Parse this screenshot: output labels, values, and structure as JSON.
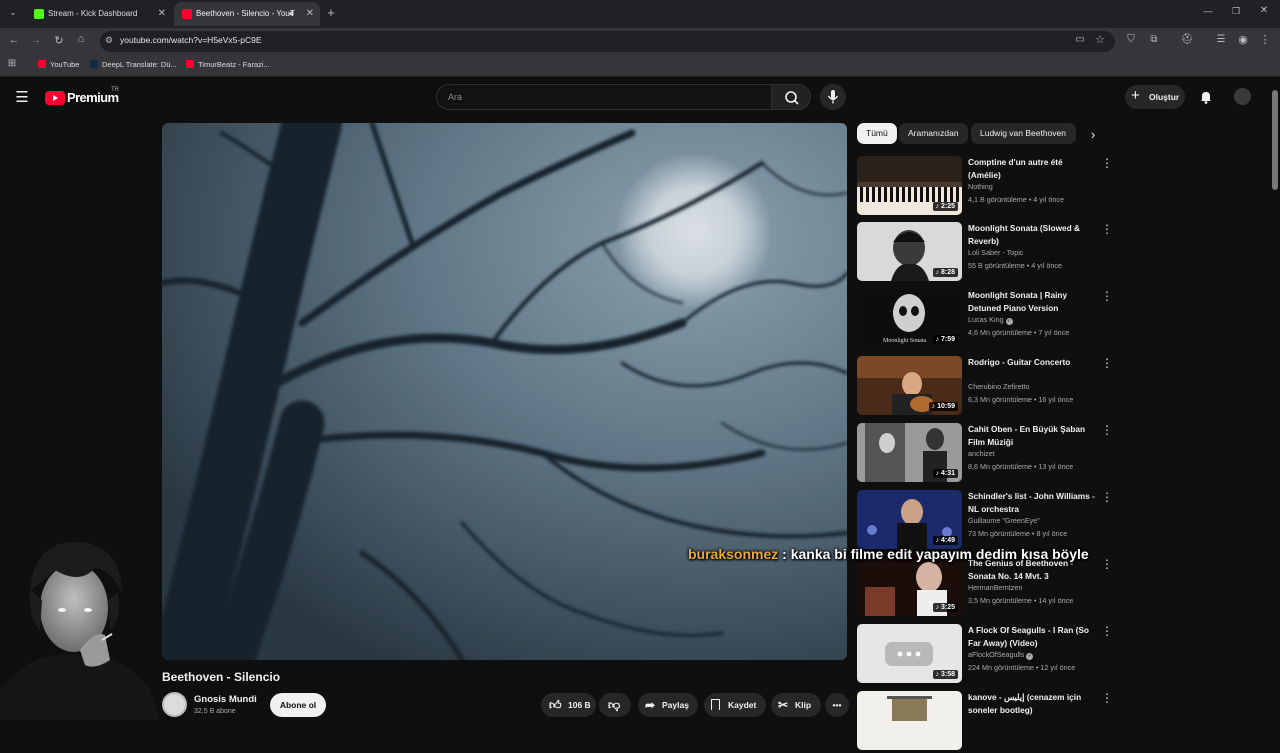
{
  "browser": {
    "tabs": [
      {
        "title": "Stream - Kick Dashboard",
        "favicon_color": "#53fc18"
      },
      {
        "title": "Beethoven - Silencio - YouT",
        "favicon_color": "#ff0033"
      }
    ],
    "new_tab_label": "+",
    "url": "youtube.com/watch?v=H5eVx5-pC9E",
    "bookmarks": [
      {
        "label": "YouTube",
        "icon_color": "#ff0033"
      },
      {
        "label": "DeepL Translate: Dü...",
        "icon_color": "#0f2b46"
      },
      {
        "label": "TimurBeatz - Farazi...",
        "icon_color": "#ff0033"
      }
    ]
  },
  "youtube": {
    "logo_text": "Premium",
    "logo_region": "TR",
    "search_placeholder": "Ara",
    "create_label": "Oluştur",
    "chips": [
      "Tümü",
      "Aramanızdan",
      "Ludwig van Beethoven"
    ],
    "video": {
      "title": "Beethoven - Silencio",
      "channel": "Gnosis Mundi",
      "subscribers": "32,5 B abone",
      "subscribe_label": "Abone ol",
      "likes": "106 B",
      "share_label": "Paylaş",
      "save_label": "Kaydet",
      "clip_label": "Klip"
    },
    "recommendations": [
      {
        "title": "Comptine d'un autre été (Amélie)",
        "channel": "Nothing",
        "verified": false,
        "meta": "4,1 B görüntüleme • 4 yıl önce",
        "duration": "2:25",
        "thumb": "piano"
      },
      {
        "title": "Moonlight Sonata (Slowed & Reverb)",
        "channel": "Loli Saber - Topic",
        "verified": false,
        "meta": "55 B görüntüleme • 4 yıl önce",
        "duration": "8:28",
        "thumb": "portrait"
      },
      {
        "title": "Moonlight Sonata | Rainy Detuned Piano Version",
        "channel": "Lucas King",
        "verified": true,
        "meta": "4,6 Mn görüntüleme • 7 yıl önce",
        "duration": "7:59",
        "thumb": "skull",
        "thumb_caption": "Moonlight Sonata"
      },
      {
        "title": "Rodrigo - Guitar Concerto",
        "channel": "Cherubino Zefiretto",
        "verified": false,
        "meta": "6,3 Mn görüntüleme • 16 yıl önce",
        "duration": "10:59",
        "thumb": "guitar"
      },
      {
        "title": "Cahit Oben - En Büyük Şaban Film Müziği",
        "channel": "anchizet",
        "verified": false,
        "meta": "8,6 Mn görüntüleme • 13 yıl önce",
        "duration": "4:31",
        "thumb": "bw"
      },
      {
        "title": "Schindler's list - John Williams - NL orchestra",
        "channel": "Guillaume \"GreenEye\"",
        "verified": false,
        "meta": "73 Mn görüntüleme • 8 yıl önce",
        "duration": "4:49",
        "thumb": "orchestra"
      },
      {
        "title": "The Genius of Beethoven - Sonata No. 14 Mvt. 3",
        "channel": "HermanBerntzen",
        "verified": false,
        "meta": "3,5 Mn görüntüleme • 14 yıl önce",
        "duration": "3:25",
        "thumb": "pianist"
      },
      {
        "title": "A Flock Of Seagulls - I Ran (So Far Away) (Video)",
        "channel": "aFlockOfSeagulls",
        "verified": true,
        "meta": "224 Mn görüntüleme • 12 yıl önce",
        "duration": "3:58",
        "thumb": "placeholder"
      },
      {
        "title": "kanove - إيليس (cenazem için soneler bootleg)",
        "channel": "",
        "verified": false,
        "meta": "",
        "duration": "",
        "thumb": "paper"
      }
    ]
  },
  "overlay": {
    "chat_user": "buraksonmez",
    "chat_message": ": kanka bi filme edit yapayım dedim kısa böyle",
    "user_color": "#e7a83c"
  }
}
